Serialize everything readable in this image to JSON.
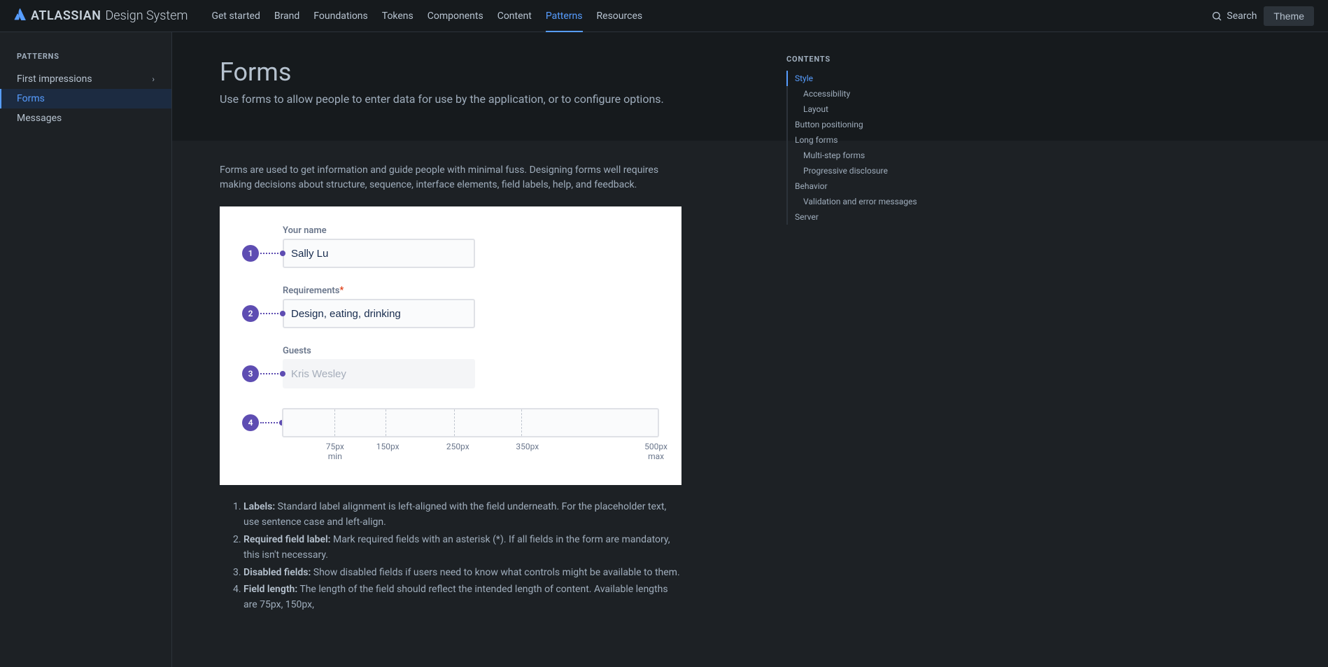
{
  "header": {
    "brand": "ATLASSIAN",
    "product": "Design System",
    "nav": [
      "Get started",
      "Brand",
      "Foundations",
      "Tokens",
      "Components",
      "Content",
      "Patterns",
      "Resources"
    ],
    "active_nav": "Patterns",
    "search_label": "Search",
    "theme_label": "Theme"
  },
  "sidebar": {
    "heading": "PATTERNS",
    "items": [
      {
        "label": "First impressions",
        "expandable": true
      },
      {
        "label": "Forms",
        "active": true
      },
      {
        "label": "Messages"
      }
    ]
  },
  "page": {
    "title": "Forms",
    "subtitle": "Use forms to allow people to enter data for use by the application, or to configure options.",
    "intro": "Forms are used to get information and guide people with minimal fuss. Designing forms well requires making decisions about structure, sequence, interface elements, field labels, help, and feedback."
  },
  "illustration": {
    "fields": [
      {
        "num": "1",
        "label": "Your name",
        "value": "Sally Lu",
        "required": false,
        "disabled": false
      },
      {
        "num": "2",
        "label": "Requirements",
        "value": "Design, eating, drinking",
        "required": true,
        "disabled": false
      },
      {
        "num": "3",
        "label": "Guests",
        "value": "Kris Wesley",
        "required": false,
        "disabled": true
      }
    ],
    "sizes_num": "4",
    "sizes": [
      {
        "label": "75px",
        "sub": "min",
        "pos_pct": 13.6
      },
      {
        "label": "150px",
        "sub": "",
        "pos_pct": 27.3
      },
      {
        "label": "250px",
        "sub": "",
        "pos_pct": 45.5
      },
      {
        "label": "350px",
        "sub": "",
        "pos_pct": 63.6
      },
      {
        "label": "500px",
        "sub": "max",
        "pos_pct": 100
      }
    ]
  },
  "notes": [
    {
      "term": "Labels:",
      "text": " Standard label alignment is left-aligned with the field underneath. For the placeholder text, use sentence case and left-align."
    },
    {
      "term": "Required field label:",
      "text": " Mark required fields with an asterisk (*). If all fields in the form are mandatory, this isn't necessary."
    },
    {
      "term": "Disabled fields:",
      "text": " Show disabled fields if users need to know what controls might be available to them."
    },
    {
      "term": "Field length:",
      "text": " The length of the field should reflect the intended length of content. Available lengths are 75px, 150px,"
    }
  ],
  "toc": {
    "heading": "CONTENTS",
    "items": [
      {
        "label": "Style",
        "active": true
      },
      {
        "label": "Accessibility",
        "sub": true
      },
      {
        "label": "Layout",
        "sub": true
      },
      {
        "label": "Button positioning"
      },
      {
        "label": "Long forms"
      },
      {
        "label": "Multi-step forms",
        "sub": true
      },
      {
        "label": "Progressive disclosure",
        "sub": true
      },
      {
        "label": "Behavior"
      },
      {
        "label": "Validation and error messages",
        "sub": true
      },
      {
        "label": "Server"
      }
    ]
  }
}
